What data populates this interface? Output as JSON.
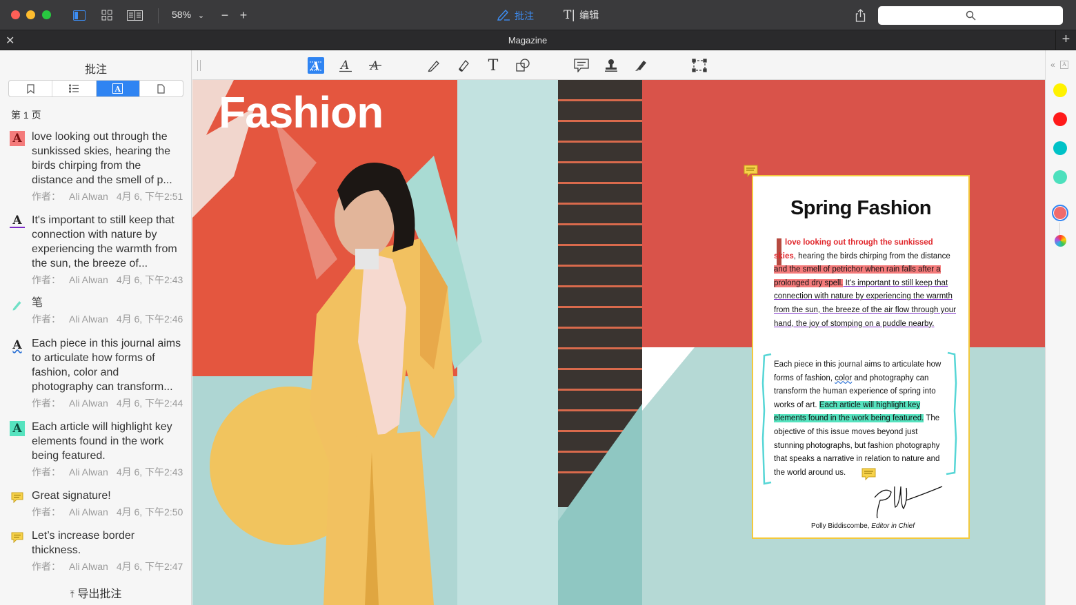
{
  "window": {
    "zoom": "58%",
    "modes": {
      "annotate": "批注",
      "edit": "编辑"
    },
    "tab_title": "Magazine"
  },
  "sidebar": {
    "title": "批注",
    "page_label": "第 1 页",
    "export_label": "导出批注",
    "annotations": [
      {
        "type": "highlight-red",
        "icon": "text-highlight-icon",
        "text": "love looking out through the sunkissed skies, hearing the birds chirping from the distance and the smell of p...",
        "author_label": "作者：",
        "author": "Ali Alwan",
        "date": "4月 6, 下午2:51"
      },
      {
        "type": "underline",
        "icon": "text-underline-icon",
        "text": "It's important to still keep that connection with nature by experiencing the warmth from the sun, the breeze of...",
        "author_label": "作者：",
        "author": "Ali Alwan",
        "date": "4月 6, 下午2:43"
      },
      {
        "type": "pen",
        "icon": "pen-icon",
        "text": "笔",
        "author_label": "作者：",
        "author": "Ali Alwan",
        "date": "4月 6, 下午2:46"
      },
      {
        "type": "squiggly",
        "icon": "text-squiggly-icon",
        "text": "Each piece in this journal aims to articulate how forms of fashion, color and photography can transform...",
        "author_label": "作者：",
        "author": "Ali Alwan",
        "date": "4月 6, 下午2:44"
      },
      {
        "type": "highlight-green",
        "icon": "text-highlight-green-icon",
        "text": "Each article will highlight key elements found in the work being featured.",
        "author_label": "作者：",
        "author": "Ali Alwan",
        "date": "4月 6, 下午2:43"
      },
      {
        "type": "note",
        "icon": "note-icon",
        "text": "Great signature!",
        "author_label": "作者：",
        "author": "Ali Alwan",
        "date": "4月 6, 下午2:50"
      },
      {
        "type": "note",
        "icon": "note-icon",
        "text": "Let’s increase border thickness.",
        "author_label": "作者：",
        "author": "Ali Alwan",
        "date": "4月 6, 下午2:47"
      }
    ]
  },
  "page": {
    "cover_title": "Fashion",
    "card": {
      "title": "Spring Fashion",
      "p1_red": "love looking out through the sunkissed skies",
      "p1_a": ", hearing the birds chirping from the distance ",
      "p1_hl": "and the smell of petrichor when rain falls after a prolonged dry spell.",
      "p1_ul": " It's important to still keep that connection with nature by experiencing the warmth from the sun, the breeze of the air flow through your hand, the joy of stomping on a puddle nearby.",
      "p2_a": "Each piece in this journal aims to articulate how forms of fashion, ",
      "p2_sq": "color",
      "p2_b": " and photography can transform the human experience of spring into works of art. ",
      "p2_hl": "Each article will highlight key elements found in the work being featured.",
      "p2_c": " The objective of this issue moves beyond just stunning photographs, but fashion photography that speaks a narrative in relation to nature and the world around us.",
      "signature_name": "Polly Biddiscombe,",
      "signature_role": "Editor in Chief"
    }
  },
  "colors": {
    "swatches": [
      "#fff200",
      "#ff1a1a",
      "#00c2c7",
      "#4de0bd",
      "#f06b6b"
    ],
    "accent": "#2f84f2"
  }
}
